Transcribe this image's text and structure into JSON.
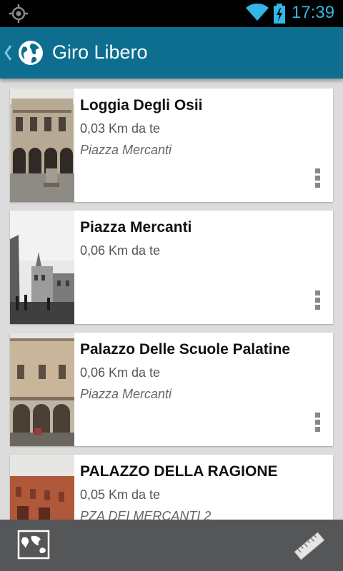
{
  "status_bar": {
    "time": "17:39",
    "icons": [
      "gps-icon",
      "wifi-icon",
      "battery-charging-icon"
    ],
    "accent": "#33b5e5"
  },
  "action_bar": {
    "title": "Giro Libero",
    "icons": [
      "back-chevron-icon",
      "globe-icon"
    ],
    "background": "#0d6e8f"
  },
  "places": [
    {
      "name": "Loggia Degli Osii",
      "distance": "0,03 Km da te",
      "address": "Piazza Mercanti"
    },
    {
      "name": "Piazza Mercanti",
      "distance": "0,06 Km da te",
      "address": ""
    },
    {
      "name": "Palazzo Delle Scuole Palatine",
      "distance": "0,06 Km da te",
      "address": "Piazza Mercanti"
    },
    {
      "name": "PALAZZO DELLA RAGIONE",
      "distance": "0,05 Km da te",
      "address": "PZA DEI MERCANTI 2"
    }
  ],
  "bottom_bar": {
    "icons": [
      "map-icon",
      "ruler-icon"
    ],
    "background": "#555658"
  }
}
